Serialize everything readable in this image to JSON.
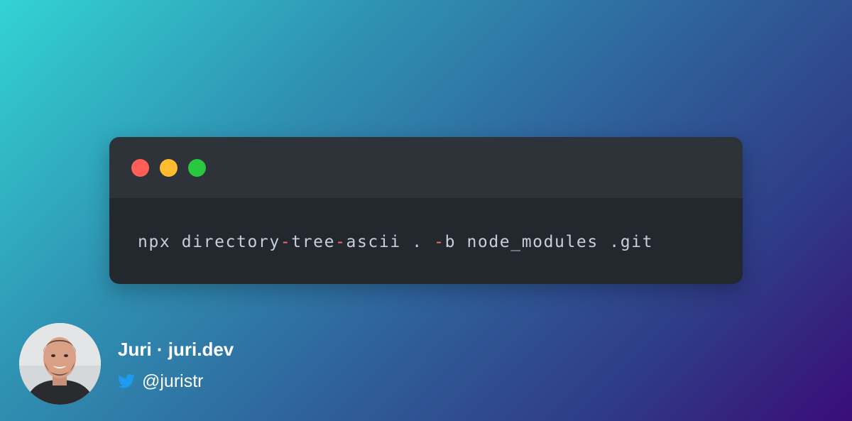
{
  "window": {
    "buttons": [
      {
        "name": "close",
        "color": "#ff5f57"
      },
      {
        "name": "minimize",
        "color": "#febc2e"
      },
      {
        "name": "maximize",
        "color": "#28c840"
      }
    ],
    "code": {
      "segments": [
        {
          "text": "npx directory",
          "type": "plain"
        },
        {
          "text": "-",
          "type": "op"
        },
        {
          "text": "tree",
          "type": "plain"
        },
        {
          "text": "-",
          "type": "op"
        },
        {
          "text": "ascii . ",
          "type": "plain"
        },
        {
          "text": "-",
          "type": "op"
        },
        {
          "text": "b node_modules .git",
          "type": "plain"
        }
      ]
    }
  },
  "author": {
    "name": "Juri · juri.dev",
    "handle": "@juristr",
    "icon": "twitter-bird-icon",
    "avatar": "profile-photo"
  },
  "colors": {
    "code_text": "#c7cfda",
    "code_operator": "#ff6f59",
    "titlebar_bg": "#2e3239",
    "code_bg": "#23272e",
    "twitter_blue": "#1d9bf0"
  }
}
